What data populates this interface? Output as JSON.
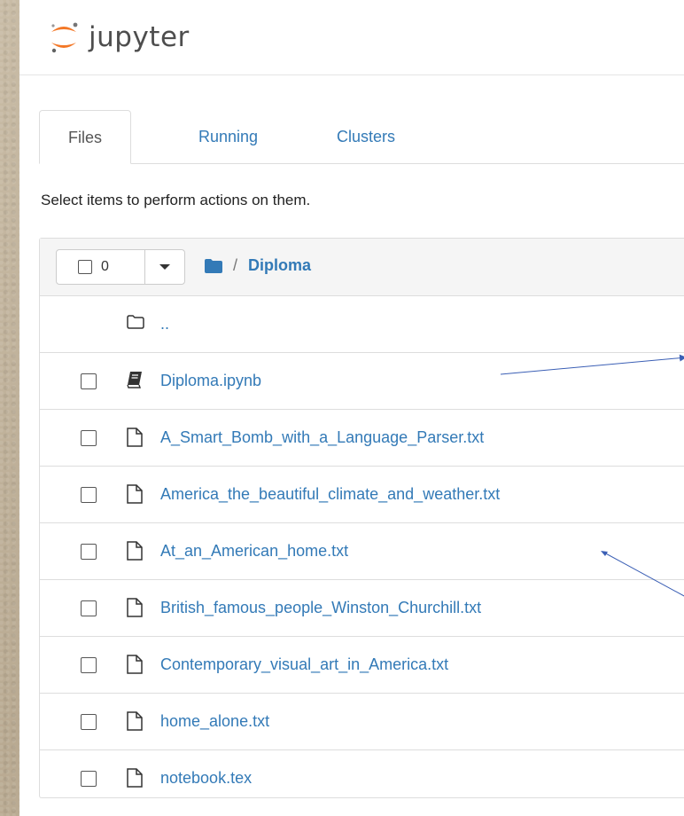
{
  "header": {
    "logo_text": "jupyter"
  },
  "tabs": [
    {
      "label": "Files",
      "active": true
    },
    {
      "label": "Running",
      "active": false
    },
    {
      "label": "Clusters",
      "active": false
    }
  ],
  "hint": "Select items to perform actions on them.",
  "toolbar": {
    "selected_count": "0"
  },
  "breadcrumb": {
    "separator": "/",
    "folder": "Diploma"
  },
  "parent_dir": {
    "label": ".."
  },
  "files": [
    {
      "name": "Diploma.ipynb",
      "icon": "notebook-icon"
    },
    {
      "name": "A_Smart_Bomb_with_a_Language_Parser.txt",
      "icon": "file-icon"
    },
    {
      "name": "America_the_beautiful_climate_and_weather.txt",
      "icon": "file-icon"
    },
    {
      "name": "At_an_American_home.txt",
      "icon": "file-icon"
    },
    {
      "name": "British_famous_people_Winston_Churchill.txt",
      "icon": "file-icon"
    },
    {
      "name": "Contemporary_visual_art_in_America.txt",
      "icon": "file-icon"
    },
    {
      "name": "home_alone.txt",
      "icon": "file-icon"
    },
    {
      "name": "notebook.tex",
      "icon": "file-icon"
    }
  ],
  "colors": {
    "link": "#337ab7",
    "logo_orange": "#f37726",
    "annotation_arrow": "#3b5fb5"
  }
}
